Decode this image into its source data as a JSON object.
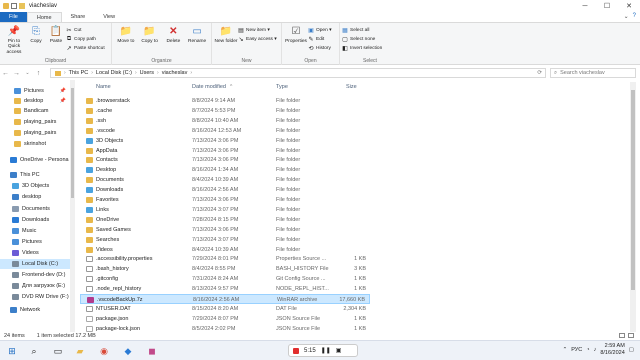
{
  "window": {
    "title": "viacheslav"
  },
  "ribbon_tabs": [
    "File",
    "Home",
    "Share",
    "View"
  ],
  "ribbon": {
    "clipboard": {
      "label": "Clipboard",
      "pin": "Pin to Quick access",
      "copy": "Copy",
      "paste": "Paste",
      "cut": "Cut",
      "copy_path": "Copy path",
      "paste_shortcut": "Paste shortcut"
    },
    "organize": {
      "label": "Organize",
      "move_to": "Move to",
      "copy_to": "Copy to",
      "delete": "Delete",
      "rename": "Rename"
    },
    "new": {
      "label": "New",
      "new_folder": "New folder",
      "new_item": "New item ▾",
      "easy_access": "Easy access ▾"
    },
    "open": {
      "label": "Open",
      "properties": "Properties",
      "open": "Open ▾",
      "edit": "Edit",
      "history": "History"
    },
    "select": {
      "label": "Select",
      "select_all": "Select all",
      "select_none": "Select none",
      "invert": "Invert selection"
    }
  },
  "address": {
    "crumbs": [
      "This PC",
      "Local Disk (C:)",
      "Users",
      "viacheslav"
    ],
    "search_placeholder": "Search viacheslav"
  },
  "nav_pane": [
    {
      "label": "Pictures",
      "pinned": true,
      "color": "#4a90d9"
    },
    {
      "label": "desktop",
      "pinned": true,
      "color": "#e8b84a"
    },
    {
      "label": "Bandicam",
      "pinned": false,
      "color": "#e8b84a"
    },
    {
      "label": "playing_pairs",
      "pinned": false,
      "color": "#e8b84a"
    },
    {
      "label": "playing_pairs",
      "pinned": false,
      "color": "#e8b84a"
    },
    {
      "label": "skrinshot",
      "pinned": false,
      "color": "#e8b84a"
    },
    {
      "label": "OneDrive - Persona",
      "pinned": false,
      "color": "#2a7bd5"
    },
    {
      "label": "This PC",
      "pinned": false,
      "color": "#3c7fc9"
    },
    {
      "label": "3D Objects",
      "pinned": false,
      "color": "#4aa3df"
    },
    {
      "label": "desktop",
      "pinned": false,
      "color": "#3c7fc9"
    },
    {
      "label": "Documents",
      "pinned": false,
      "color": "#8a9bb0"
    },
    {
      "label": "Downloads",
      "pinned": false,
      "color": "#2a7bd5"
    },
    {
      "label": "Music",
      "pinned": false,
      "color": "#4a90d9"
    },
    {
      "label": "Pictures",
      "pinned": false,
      "color": "#4a90d9"
    },
    {
      "label": "Videos",
      "pinned": false,
      "color": "#6b5bd6"
    },
    {
      "label": "Local Disk (C:)",
      "pinned": false,
      "color": "#7a8a9a"
    },
    {
      "label": "Frontend-dev (D:)",
      "pinned": false,
      "color": "#7a8a9a"
    },
    {
      "label": "Для загрузок (E:)",
      "pinned": false,
      "color": "#7a8a9a"
    },
    {
      "label": "DVD RW Drive (F:)",
      "pinned": false,
      "color": "#7a8a9a"
    },
    {
      "label": "Network",
      "pinned": false,
      "color": "#3c7fc9"
    }
  ],
  "columns": {
    "name": "Name",
    "date": "Date modified",
    "type": "Type",
    "size": "Size"
  },
  "files": [
    {
      "name": ".browserstack",
      "date": "8/8/2024 9:14 AM",
      "type": "File folder",
      "size": "",
      "kind": "folder"
    },
    {
      "name": ".cache",
      "date": "8/7/2024 5:53 PM",
      "type": "File folder",
      "size": "",
      "kind": "folder"
    },
    {
      "name": ".ssh",
      "date": "8/8/2024 10:40 AM",
      "type": "File folder",
      "size": "",
      "kind": "folder"
    },
    {
      "name": ".vscode",
      "date": "8/16/2024 12:53 AM",
      "type": "File folder",
      "size": "",
      "kind": "folder"
    },
    {
      "name": "3D Objects",
      "date": "7/13/2024 3:06 PM",
      "type": "File folder",
      "size": "",
      "kind": "folder-blue"
    },
    {
      "name": "AppData",
      "date": "7/13/2024 3:06 PM",
      "type": "File folder",
      "size": "",
      "kind": "folder"
    },
    {
      "name": "Contacts",
      "date": "7/13/2024 3:06 PM",
      "type": "File folder",
      "size": "",
      "kind": "folder"
    },
    {
      "name": "Desktop",
      "date": "8/16/2024 1:34 AM",
      "type": "File folder",
      "size": "",
      "kind": "folder-blue"
    },
    {
      "name": "Documents",
      "date": "8/4/2024 10:39 AM",
      "type": "File folder",
      "size": "",
      "kind": "folder"
    },
    {
      "name": "Downloads",
      "date": "8/16/2024 2:56 AM",
      "type": "File folder",
      "size": "",
      "kind": "folder-blue"
    },
    {
      "name": "Favorites",
      "date": "7/13/2024 3:06 PM",
      "type": "File folder",
      "size": "",
      "kind": "folder"
    },
    {
      "name": "Links",
      "date": "7/13/2024 3:07 PM",
      "type": "File folder",
      "size": "",
      "kind": "folder-blue"
    },
    {
      "name": "OneDrive",
      "date": "7/28/2024 8:15 PM",
      "type": "File folder",
      "size": "",
      "kind": "folder"
    },
    {
      "name": "Saved Games",
      "date": "7/13/2024 3:06 PM",
      "type": "File folder",
      "size": "",
      "kind": "folder"
    },
    {
      "name": "Searches",
      "date": "7/13/2024 3:07 PM",
      "type": "File folder",
      "size": "",
      "kind": "folder"
    },
    {
      "name": "Videos",
      "date": "8/4/2024 10:39 AM",
      "type": "File folder",
      "size": "",
      "kind": "folder"
    },
    {
      "name": ".accessibility.properties",
      "date": "7/29/2024 8:01 PM",
      "type": "Properties Source ...",
      "size": "1 KB",
      "kind": "doc"
    },
    {
      "name": ".bash_history",
      "date": "8/4/2024 8:55 PM",
      "type": "BASH_HISTORY File",
      "size": "3 KB",
      "kind": "doc"
    },
    {
      "name": ".gitconfig",
      "date": "7/31/2024 8:24 AM",
      "type": "Git Config Source ...",
      "size": "1 KB",
      "kind": "doc"
    },
    {
      "name": ".node_repl_history",
      "date": "8/13/2024 9:57 PM",
      "type": "NODE_REPL_HIST...",
      "size": "1 KB",
      "kind": "doc"
    },
    {
      "name": ".vscodeBackUp.7z",
      "date": "8/16/2024 2:56 AM",
      "type": "WinRAR archive",
      "size": "17,660 KB",
      "kind": "rar",
      "selected": true
    },
    {
      "name": "NTUSER.DAT",
      "date": "8/15/2024 8:20 AM",
      "type": "DAT File",
      "size": "2,304 KB",
      "kind": "doc"
    },
    {
      "name": "package.json",
      "date": "7/29/2024 8:07 PM",
      "type": "JSON Source File",
      "size": "1 KB",
      "kind": "json"
    },
    {
      "name": "package-lock.json",
      "date": "8/5/2024 2:02 PM",
      "type": "JSON Source File",
      "size": "1 KB",
      "kind": "json"
    }
  ],
  "status": {
    "count": "24 items",
    "selected": "1 item selected  17.2 MB"
  },
  "taskbar": {
    "recording_time": "5:15",
    "language": "РУС",
    "time": "2:59 AM",
    "date": "8/16/2024"
  }
}
